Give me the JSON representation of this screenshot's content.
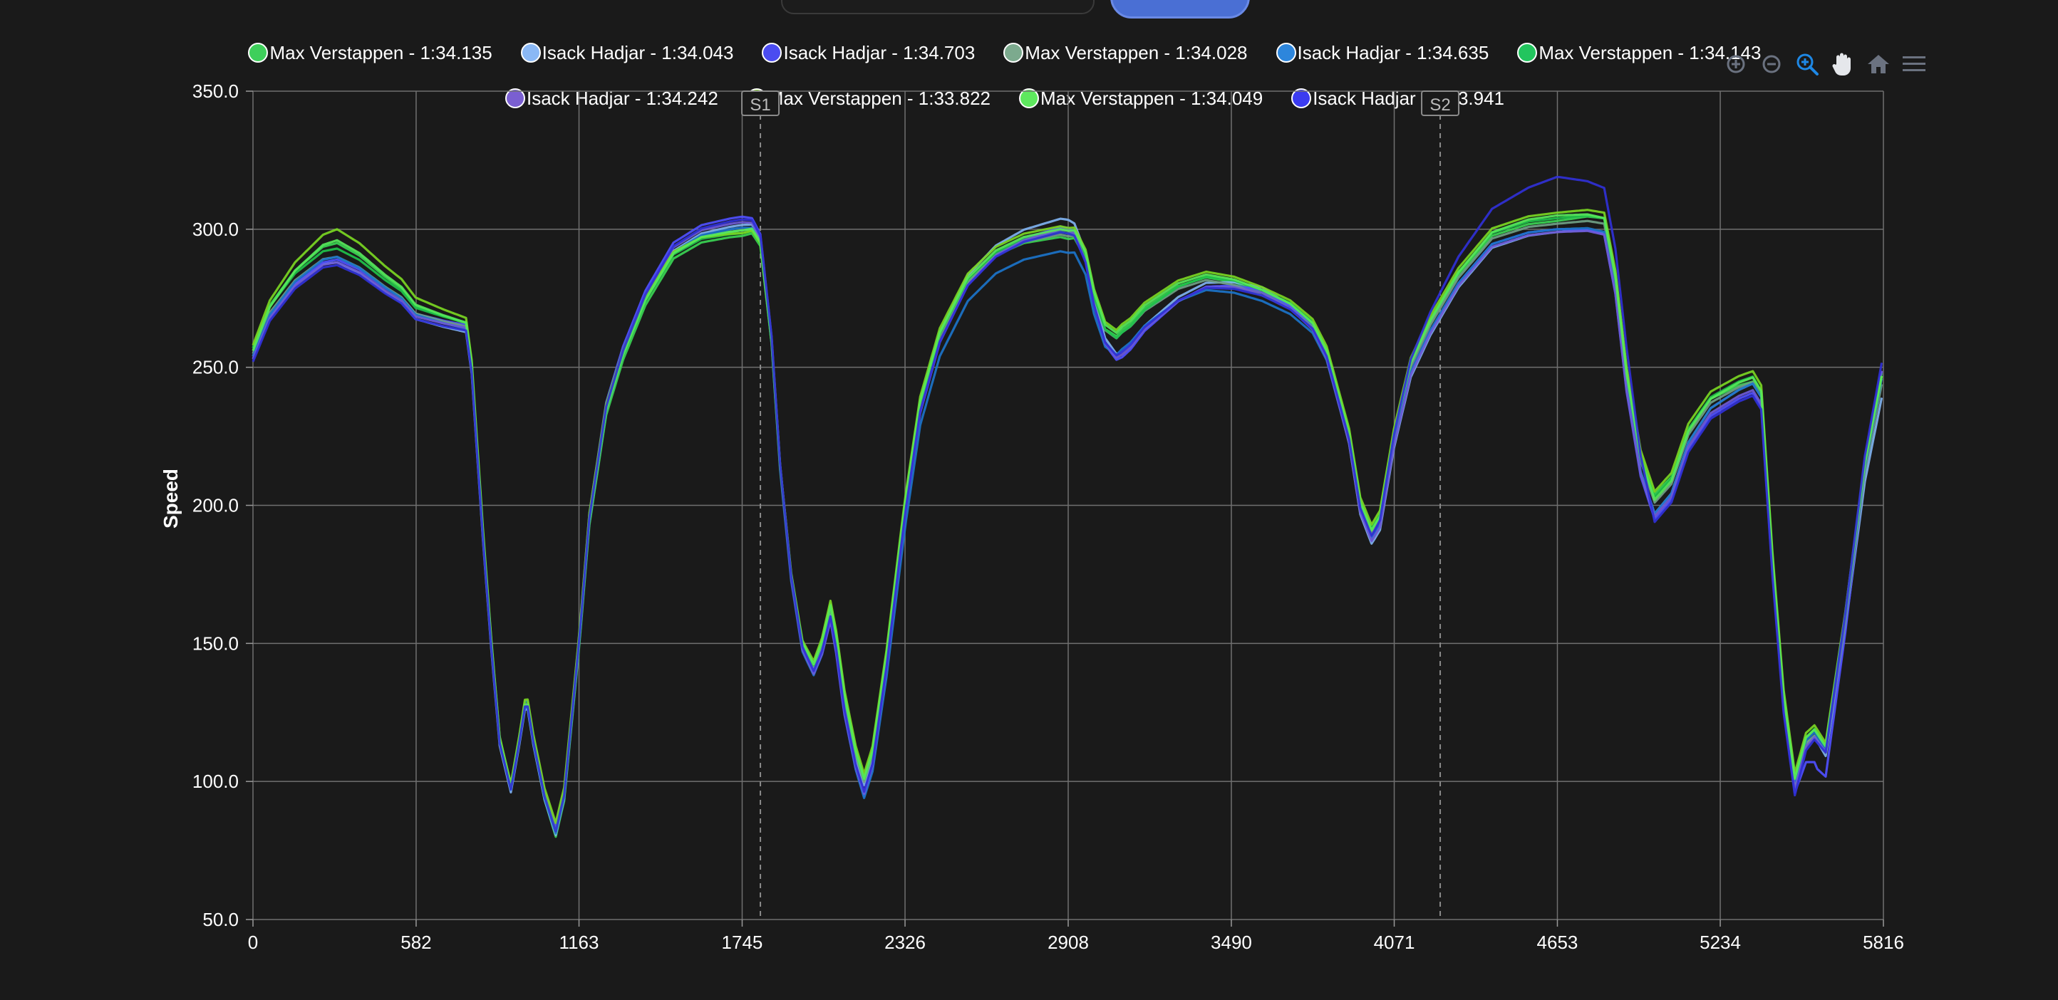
{
  "chart_data": {
    "type": "line",
    "title": "",
    "xlabel": "",
    "ylabel": "Speed",
    "xlim": [
      0,
      5816
    ],
    "ylim": [
      50,
      350
    ],
    "x_ticks": [
      "0",
      "582",
      "1163",
      "1745",
      "2326",
      "2908",
      "3490",
      "4071",
      "4653",
      "5234",
      "5816"
    ],
    "y_ticks": [
      "50.0",
      "100.0",
      "150.0",
      "200.0",
      "250.0",
      "300.0",
      "350.0"
    ],
    "grid": true,
    "legend_position": "top",
    "sector_markers": [
      {
        "label": "S1",
        "x": 1810
      },
      {
        "label": "S2",
        "x": 4235
      }
    ],
    "series": [
      {
        "name": "Max Verstappen - 1:34.135",
        "color": "#39d353",
        "marker": "#3ecf5b",
        "offsets": [
          [
            0,
            2
          ],
          [
            300,
            4
          ],
          [
            900,
            0
          ],
          [
            1080,
            -2
          ],
          [
            1745,
            -3
          ],
          [
            2100,
            2
          ],
          [
            2908,
            -3
          ],
          [
            3100,
            4
          ],
          [
            3600,
            0
          ],
          [
            4000,
            1
          ],
          [
            4653,
            2
          ],
          [
            5000,
            4
          ],
          [
            5500,
            -2
          ],
          [
            5816,
            0
          ]
        ]
      },
      {
        "name": "Isack Hadjar - 1:34.043",
        "color": "#7fb2f0",
        "marker": "#8ab8f5",
        "offsets": [
          [
            0,
            -1
          ],
          [
            300,
            -3
          ],
          [
            900,
            -2
          ],
          [
            1745,
            1
          ],
          [
            2100,
            -2
          ],
          [
            2908,
            4
          ],
          [
            3100,
            -4
          ],
          [
            3600,
            2
          ],
          [
            4000,
            -4
          ],
          [
            4653,
            -2
          ],
          [
            5000,
            -3
          ],
          [
            5500,
            0
          ],
          [
            5816,
            -8
          ]
        ]
      },
      {
        "name": "Isack Hadjar - 1:34.703",
        "color": "#4f4fff",
        "marker": "#4b4cf0",
        "offsets": [
          [
            0,
            -2
          ],
          [
            300,
            -2
          ],
          [
            900,
            1
          ],
          [
            1745,
            4
          ],
          [
            2100,
            -6
          ],
          [
            2908,
            1
          ],
          [
            3100,
            -6
          ],
          [
            3600,
            1
          ],
          [
            4000,
            -2
          ],
          [
            4653,
            -1
          ],
          [
            5000,
            -5
          ],
          [
            5500,
            -4
          ],
          [
            5580,
            -12
          ],
          [
            5816,
            2
          ]
        ]
      },
      {
        "name": "Max Verstappen - 1:34.028",
        "color": "#6f9f85",
        "marker": "#7caa8e",
        "offsets": [
          [
            0,
            0
          ],
          [
            300,
            -1
          ],
          [
            900,
            0
          ],
          [
            1745,
            -1
          ],
          [
            2100,
            0
          ],
          [
            2908,
            -2
          ],
          [
            3100,
            3
          ],
          [
            3600,
            -1
          ],
          [
            4000,
            0
          ],
          [
            4653,
            1
          ],
          [
            5000,
            1
          ],
          [
            5500,
            -1
          ],
          [
            5816,
            -3
          ]
        ]
      },
      {
        "name": "Isack Hadjar - 1:34.635",
        "color": "#1b73c9",
        "marker": "#2d86dc",
        "offsets": [
          [
            0,
            -1
          ],
          [
            300,
            -1
          ],
          [
            900,
            -1
          ],
          [
            1745,
            0
          ],
          [
            2326,
            -8
          ],
          [
            2908,
            -8
          ],
          [
            3100,
            -3
          ],
          [
            3600,
            -3
          ],
          [
            4000,
            -2
          ],
          [
            4653,
            -1
          ],
          [
            5000,
            -3
          ],
          [
            5500,
            0
          ],
          [
            5816,
            -1
          ]
        ]
      },
      {
        "name": "Max Verstappen - 1:34.143",
        "color": "#1fc14a",
        "marker": "#22c55e",
        "offsets": [
          [
            0,
            2
          ],
          [
            300,
            2
          ],
          [
            900,
            1
          ],
          [
            1745,
            -2
          ],
          [
            2100,
            1
          ],
          [
            2908,
            -1
          ],
          [
            3100,
            3
          ],
          [
            3600,
            1
          ],
          [
            4000,
            2
          ],
          [
            4653,
            3
          ],
          [
            5000,
            3
          ],
          [
            5500,
            1
          ],
          [
            5816,
            1
          ]
        ]
      },
      {
        "name": "Isack Hadjar - 1:34.242",
        "color": "#6e5ad6",
        "marker": "#7a5fd1",
        "offsets": [
          [
            0,
            -2
          ],
          [
            300,
            -3
          ],
          [
            900,
            0
          ],
          [
            1745,
            2
          ],
          [
            2100,
            -5
          ],
          [
            2908,
            0
          ],
          [
            3100,
            -5
          ],
          [
            3600,
            0
          ],
          [
            4000,
            -3
          ],
          [
            4653,
            -2
          ],
          [
            5000,
            -4
          ],
          [
            5500,
            -3
          ],
          [
            5816,
            2
          ]
        ]
      },
      {
        "name": "Max Verstappen - 1:33.822",
        "color": "#7ad622",
        "marker": "#84d62a",
        "offsets": [
          [
            0,
            3
          ],
          [
            300,
            9
          ],
          [
            900,
            1
          ],
          [
            1080,
            3
          ],
          [
            1745,
            -2
          ],
          [
            2100,
            3
          ],
          [
            2908,
            1
          ],
          [
            3100,
            6
          ],
          [
            3600,
            2
          ],
          [
            4000,
            3
          ],
          [
            4653,
            5
          ],
          [
            5000,
            5
          ],
          [
            5500,
            3
          ],
          [
            5816,
            0
          ]
        ]
      },
      {
        "name": "Max Verstappen - 1:34.049",
        "color": "#57e85a",
        "marker": "#5ee85e",
        "offsets": [
          [
            0,
            1
          ],
          [
            300,
            5
          ],
          [
            900,
            0
          ],
          [
            1745,
            -1
          ],
          [
            2100,
            1
          ],
          [
            2908,
            0
          ],
          [
            3100,
            5
          ],
          [
            3600,
            1
          ],
          [
            4000,
            1
          ],
          [
            4653,
            4
          ],
          [
            5000,
            2
          ],
          [
            5500,
            1
          ],
          [
            5816,
            0
          ]
        ]
      },
      {
        "name": "Isack Hadjar - 1:33.941",
        "color": "#3030d6",
        "marker": "#3b3bf0",
        "offsets": [
          [
            0,
            -3
          ],
          [
            300,
            -4
          ],
          [
            900,
            -1
          ],
          [
            1745,
            3
          ],
          [
            2100,
            -4
          ],
          [
            2908,
            -1
          ],
          [
            3100,
            -4
          ],
          [
            3600,
            -1
          ],
          [
            4000,
            -1
          ],
          [
            4300,
            8
          ],
          [
            4653,
            18
          ],
          [
            4900,
            12
          ],
          [
            5000,
            -6
          ],
          [
            5500,
            -5
          ],
          [
            5816,
            5
          ]
        ]
      }
    ],
    "base_trace": [
      [
        0,
        255
      ],
      [
        60,
        270
      ],
      [
        150,
        282
      ],
      [
        250,
        290
      ],
      [
        300,
        291
      ],
      [
        380,
        287
      ],
      [
        470,
        280
      ],
      [
        530,
        276
      ],
      [
        580,
        270
      ],
      [
        680,
        267
      ],
      [
        760,
        265
      ],
      [
        780,
        250
      ],
      [
        820,
        190
      ],
      [
        850,
        150
      ],
      [
        880,
        115
      ],
      [
        920,
        98
      ],
      [
        950,
        115
      ],
      [
        975,
        131
      ],
      [
        1000,
        115
      ],
      [
        1040,
        95
      ],
      [
        1080,
        82
      ],
      [
        1110,
        95
      ],
      [
        1163,
        150
      ],
      [
        1200,
        195
      ],
      [
        1260,
        235
      ],
      [
        1320,
        255
      ],
      [
        1400,
        275
      ],
      [
        1500,
        292
      ],
      [
        1600,
        298
      ],
      [
        1700,
        300
      ],
      [
        1780,
        301
      ],
      [
        1810,
        296
      ],
      [
        1850,
        260
      ],
      [
        1880,
        215
      ],
      [
        1920,
        175
      ],
      [
        1960,
        150
      ],
      [
        2000,
        142
      ],
      [
        2030,
        150
      ],
      [
        2060,
        163
      ],
      [
        2080,
        152
      ],
      [
        2110,
        130
      ],
      [
        2150,
        110
      ],
      [
        2180,
        100
      ],
      [
        2210,
        110
      ],
      [
        2260,
        145
      ],
      [
        2326,
        200
      ],
      [
        2380,
        237
      ],
      [
        2450,
        262
      ],
      [
        2550,
        282
      ],
      [
        2650,
        292
      ],
      [
        2750,
        297
      ],
      [
        2880,
        300
      ],
      [
        2930,
        299
      ],
      [
        2970,
        290
      ],
      [
        3000,
        275
      ],
      [
        3040,
        262
      ],
      [
        3080,
        258
      ],
      [
        3130,
        262
      ],
      [
        3180,
        268
      ],
      [
        3300,
        277
      ],
      [
        3400,
        281
      ],
      [
        3500,
        280
      ],
      [
        3600,
        277
      ],
      [
        3700,
        272
      ],
      [
        3780,
        265
      ],
      [
        3830,
        255
      ],
      [
        3870,
        240
      ],
      [
        3910,
        225
      ],
      [
        3950,
        200
      ],
      [
        3990,
        190
      ],
      [
        4020,
        195
      ],
      [
        4071,
        225
      ],
      [
        4130,
        250
      ],
      [
        4200,
        265
      ],
      [
        4300,
        282
      ],
      [
        4420,
        296
      ],
      [
        4550,
        300
      ],
      [
        4653,
        301
      ],
      [
        4760,
        302
      ],
      [
        4820,
        301
      ],
      [
        4860,
        280
      ],
      [
        4900,
        245
      ],
      [
        4950,
        215
      ],
      [
        5000,
        200
      ],
      [
        5060,
        207
      ],
      [
        5120,
        225
      ],
      [
        5200,
        237
      ],
      [
        5300,
        243
      ],
      [
        5350,
        245
      ],
      [
        5380,
        240
      ],
      [
        5420,
        180
      ],
      [
        5460,
        130
      ],
      [
        5500,
        100
      ],
      [
        5540,
        115
      ],
      [
        5570,
        118
      ],
      [
        5610,
        112
      ],
      [
        5680,
        160
      ],
      [
        5750,
        215
      ],
      [
        5816,
        250
      ]
    ]
  }
}
